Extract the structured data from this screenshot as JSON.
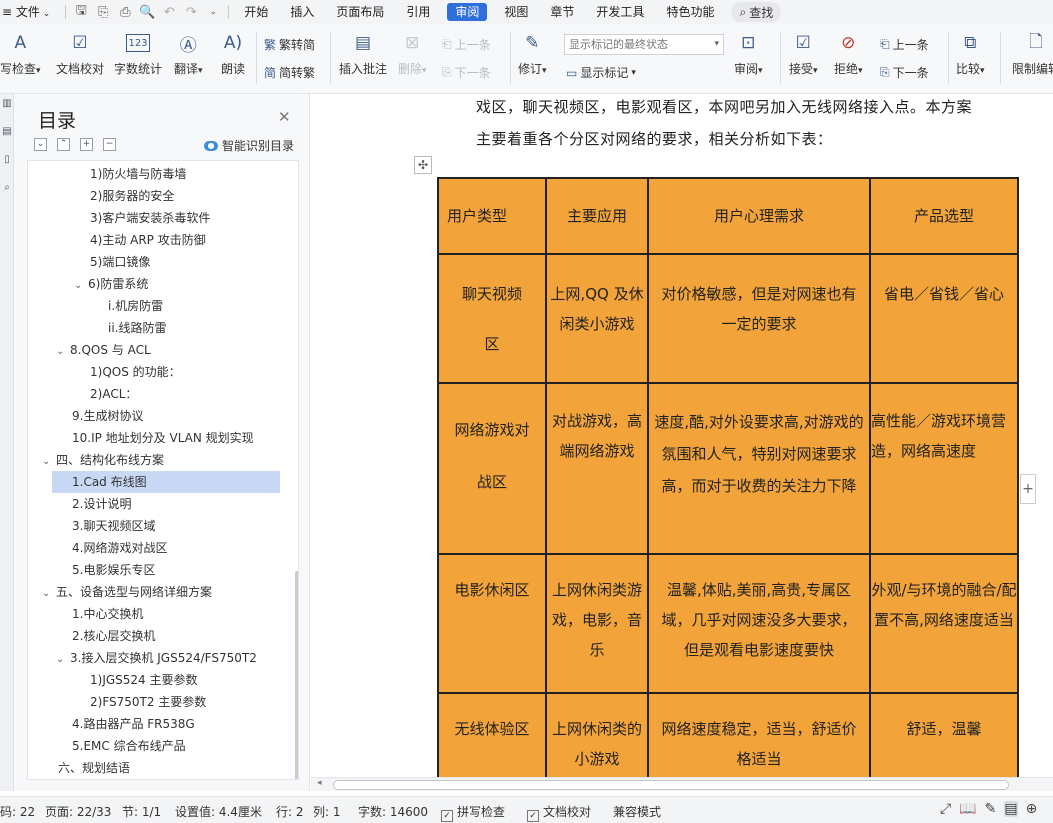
{
  "menubar": {
    "file": "文件",
    "tabs": [
      "开始",
      "插入",
      "页面布局",
      "引用",
      "审阅",
      "视图",
      "章节",
      "开发工具",
      "特色功能"
    ],
    "active_tab": "审阅",
    "search": "查找"
  },
  "ribbon": {
    "spell_check": "写检查",
    "doc_proof": "文档校对",
    "word_count": "字数统计",
    "word_count_icon_text": "123",
    "translate": "翻译",
    "read_aloud": "朗读",
    "trad_to_simp": "繁转简",
    "simp_to_trad": "简转繁",
    "insert_comment": "插入批注",
    "delete": "删除",
    "prev_comment": "上一条",
    "next_comment": "下一条",
    "track_changes": "修订",
    "show_markup_select": "显示标记的最终状态",
    "show_markup": "显示标记",
    "review": "审阅",
    "accept": "接受",
    "reject": "拒绝",
    "prev_change": "上一条",
    "next_change": "下一条",
    "compare": "比较",
    "restrict_edit": "限制编辑"
  },
  "toc": {
    "title": "目录",
    "smart_label": "智能识别目录",
    "items": [
      {
        "label": "1)防火墙与防毒墙",
        "level": 3
      },
      {
        "label": "2)服务器的安全",
        "level": 3
      },
      {
        "label": "3)客户端安装杀毒软件",
        "level": 3
      },
      {
        "label": "4)主动 ARP 攻击防御",
        "level": 3
      },
      {
        "label": "5)端口镜像",
        "level": 3
      },
      {
        "label": "6)防雷系统",
        "level": 3,
        "expanded": true
      },
      {
        "label": "i.机房防雷",
        "level": 4
      },
      {
        "label": "ii.线路防雷",
        "level": 4
      },
      {
        "label": "8.QOS 与 ACL",
        "level": 2,
        "expanded": true
      },
      {
        "label": "1)QOS 的功能：",
        "level": 3
      },
      {
        "label": "2)ACL：",
        "level": 3
      },
      {
        "label": "9.生成树协议",
        "level": 2
      },
      {
        "label": "10.IP 地址划分及 VLAN 规划实现",
        "level": 2
      },
      {
        "label": "四、结构化布线方案",
        "level": 1,
        "expanded": true
      },
      {
        "label": "1.Cad 布线图",
        "level": 2,
        "selected": true
      },
      {
        "label": "2.设计说明",
        "level": 2
      },
      {
        "label": "3.聊天视频区域",
        "level": 2
      },
      {
        "label": "4.网络游戏对战区",
        "level": 2
      },
      {
        "label": "5.电影娱乐专区",
        "level": 2
      },
      {
        "label": "五、设备选型与网络详细方案",
        "level": 1,
        "expanded": true
      },
      {
        "label": "1.中心交换机",
        "level": 2
      },
      {
        "label": "2.核心层交换机",
        "level": 2
      },
      {
        "label": "3.接入层交换机 JGS524/FS750T2",
        "level": 2,
        "expanded": true
      },
      {
        "label": "1)JGS524 主要参数",
        "level": 3
      },
      {
        "label": "2)FS750T2 主要参数",
        "level": 3
      },
      {
        "label": "4.路由器产品  FR538G",
        "level": 2
      },
      {
        "label": "5.EMC 综合布线产品",
        "level": 2
      },
      {
        "label": "六、规划结语",
        "level": 1
      }
    ]
  },
  "document": {
    "para_line1": "戏区，聊天视频区，电影观看区，本网吧另加入无线网络接入点。本方案",
    "para_line2": "主要着重各个分区对网络的要求，相关分析如下表：",
    "table_header": [
      "用户类型",
      "主要应用",
      "用户心理需求",
      "产品选型"
    ],
    "table_rows": [
      [
        "聊天视频区",
        "上网,QQ 及休闲类小游戏",
        "对价格敏感，但是对网速也有一定的要求",
        "省电／省钱／省心"
      ],
      [
        "网络游戏对战区",
        "对战游戏，高端网络游戏",
        "速度,酷,对外设要求高,对游戏的氛围和人气，特别对网速要求高，而对于收费的关注力下降",
        "高性能／游戏环境营造，网络高速度"
      ],
      [
        "电影休闲区",
        "上网休闲类游戏，电影，音乐",
        "温馨,体贴,美丽,高贵,专属区域，几乎对网速没多大要求，但是观看电影速度要快",
        "外观/与环境的融合/配置不高,网络速度适当"
      ],
      [
        "无线体验区",
        "上网休闲类的小游戏",
        "网络速度稳定，适当，舒适价格适当",
        "舒适，温馨"
      ]
    ],
    "cell_color": "#f2a43a"
  },
  "status": {
    "page_num": "码: 22",
    "page": "页面: 22/33",
    "section": "节: 1/1",
    "setting": "设置值: 4.4厘米",
    "row": "行: 2",
    "col": "列: 1",
    "chars": "字数: 14600",
    "spell": "拼写检查",
    "doc_check": "文档校对",
    "compat": "兼容模式"
  }
}
